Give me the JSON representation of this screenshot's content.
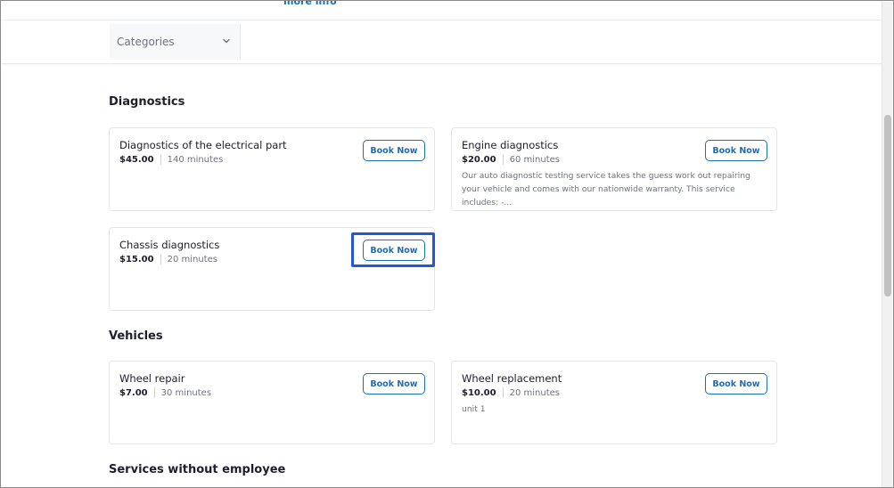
{
  "top_strip": {
    "cut_text": "",
    "cut_link": "more info"
  },
  "filter": {
    "categories_label": "Categories",
    "chevron_icon": "chevron-down-icon"
  },
  "sections": [
    {
      "title": "Diagnostics",
      "services": [
        {
          "title": "Diagnostics of the electrical part",
          "price": "$45.00",
          "duration": "140 minutes",
          "description": "",
          "button": "Book Now"
        },
        {
          "title": "Engine diagnostics",
          "price": "$20.00",
          "duration": "60 minutes",
          "description": "Our auto diagnostic testing service takes the guess work out repairing your vehicle and comes with our nationwide warranty. This service includes: -...",
          "button": "Book Now"
        },
        {
          "title": "Chassis diagnostics",
          "price": "$15.00",
          "duration": "20 minutes",
          "description": "",
          "button": "Book Now"
        }
      ]
    },
    {
      "title": "Vehicles",
      "services": [
        {
          "title": "Wheel repair",
          "price": "$7.00",
          "duration": "30 minutes",
          "description": "",
          "button": "Book Now"
        },
        {
          "title": "Wheel replacement",
          "price": "$10.00",
          "duration": "20 minutes",
          "description": "unit 1",
          "button": "Book Now"
        }
      ]
    },
    {
      "title": "Services without employee",
      "services": []
    }
  ],
  "colors": {
    "accent": "#1a6fb5",
    "highlight": "#2457d6",
    "text": "#1e1e2d",
    "muted": "#6f7380"
  }
}
